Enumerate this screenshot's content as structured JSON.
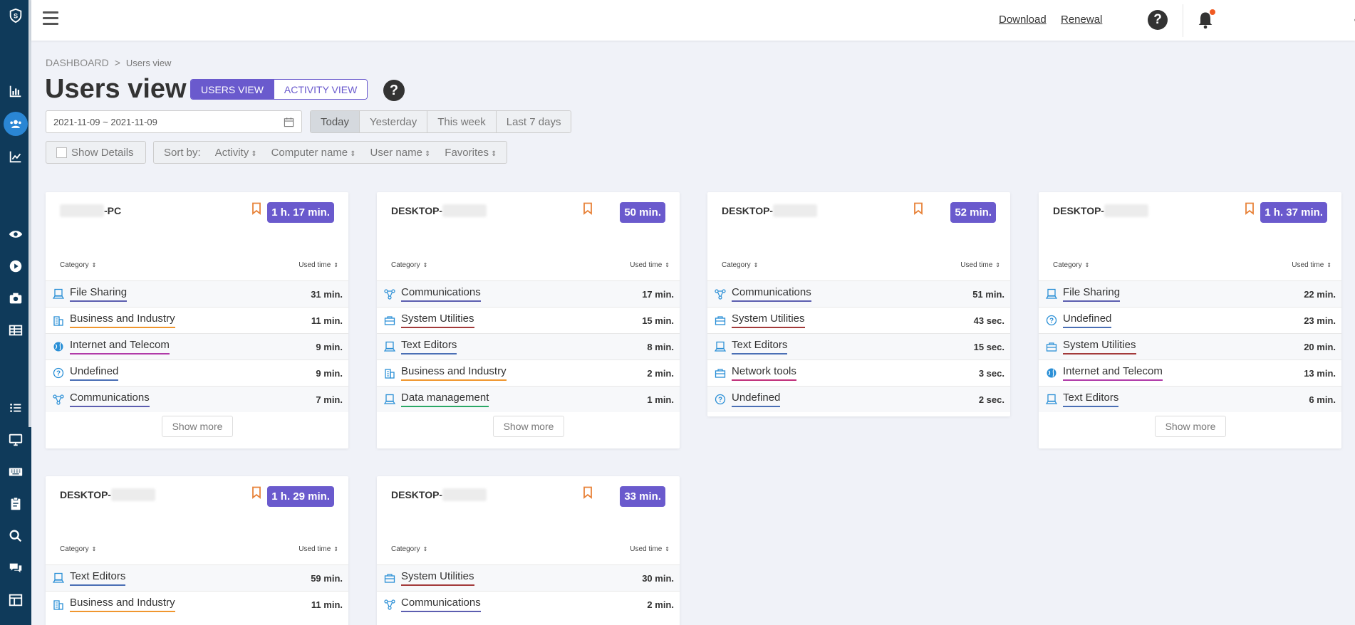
{
  "topbar": {
    "download": "Download",
    "renewal": "Renewal",
    "help": "?"
  },
  "breadcrumb": {
    "root": "DASHBOARD",
    "separator": ">",
    "current": "Users view"
  },
  "page_title": "Users view",
  "view_toggle": {
    "users": "USERS VIEW",
    "activity": "ACTIVITY VIEW"
  },
  "title_help": "?",
  "date_range": "2021-11-09 ~ 2021-11-09",
  "date_buttons": [
    "Today",
    "Yesterday",
    "This week",
    "Last 7 days"
  ],
  "show_details": "Show Details",
  "sort": {
    "label": "Sort by:",
    "options": [
      "Activity",
      "Computer name",
      "User name",
      "Favorites"
    ]
  },
  "table_headers": {
    "category": "Category",
    "used_time": "Used time"
  },
  "show_more": "Show more",
  "colors": {
    "accent": "#6a5acd",
    "sidebar": "#0f3a5a",
    "bookmark": "#e8833a"
  },
  "cards": [
    {
      "prefix": "",
      "suffix": "-PC",
      "time": "1 h. 17 min.",
      "rows": [
        {
          "icon": "computer-icon",
          "name": "File Sharing",
          "time": "31 min."
        },
        {
          "icon": "building-icon",
          "name": "Business and Industry",
          "time": "11 min."
        },
        {
          "icon": "globe-icon",
          "name": "Internet and Telecom",
          "time": "9 min."
        },
        {
          "icon": "question-circle-icon",
          "name": "Undefined",
          "time": "9 min."
        },
        {
          "icon": "network-icon",
          "name": "Communications",
          "time": "7 min."
        }
      ]
    },
    {
      "prefix": "DESKTOP-",
      "suffix": "",
      "time": "50 min.",
      "rows": [
        {
          "icon": "network-icon",
          "name": "Communications",
          "time": "17 min."
        },
        {
          "icon": "toolbox-icon",
          "name": "System Utilities",
          "time": "15 min."
        },
        {
          "icon": "computer-icon",
          "name": "Text Editors",
          "time": "8 min."
        },
        {
          "icon": "building-icon",
          "name": "Business and Industry",
          "time": "2 min."
        },
        {
          "icon": "computer-icon",
          "name": "Data management",
          "time": "1 min."
        }
      ]
    },
    {
      "prefix": "DESKTOP-",
      "suffix": "",
      "time": "52 min.",
      "rows": [
        {
          "icon": "network-icon",
          "name": "Communications",
          "time": "51 min."
        },
        {
          "icon": "toolbox-icon",
          "name": "System Utilities",
          "time": "43 sec."
        },
        {
          "icon": "computer-icon",
          "name": "Text Editors",
          "time": "15 sec."
        },
        {
          "icon": "toolbox-icon",
          "name": "Network tools",
          "time": "3 sec."
        },
        {
          "icon": "question-circle-icon",
          "name": "Undefined",
          "time": "2 sec."
        }
      ]
    },
    {
      "prefix": "DESKTOP-",
      "suffix": "",
      "time": "1 h. 37 min.",
      "rows": [
        {
          "icon": "computer-icon",
          "name": "File Sharing",
          "time": "22 min."
        },
        {
          "icon": "question-circle-icon",
          "name": "Undefined",
          "time": "23 min."
        },
        {
          "icon": "toolbox-icon",
          "name": "System Utilities",
          "time": "20 min."
        },
        {
          "icon": "globe-icon",
          "name": "Internet and Telecom",
          "time": "13 min."
        },
        {
          "icon": "computer-icon",
          "name": "Text Editors",
          "time": "6 min."
        }
      ]
    },
    {
      "prefix": "DESKTOP-",
      "suffix": "",
      "time": "1 h. 29 min.",
      "rows": [
        {
          "icon": "computer-icon",
          "name": "Text Editors",
          "time": "59 min."
        },
        {
          "icon": "building-icon",
          "name": "Business and Industry",
          "time": "11 min."
        }
      ]
    },
    {
      "prefix": "DESKTOP-",
      "suffix": "",
      "time": "33 min.",
      "rows": [
        {
          "icon": "toolbox-icon",
          "name": "System Utilities",
          "time": "30 min."
        },
        {
          "icon": "network-icon",
          "name": "Communications",
          "time": "2 min."
        }
      ]
    }
  ]
}
